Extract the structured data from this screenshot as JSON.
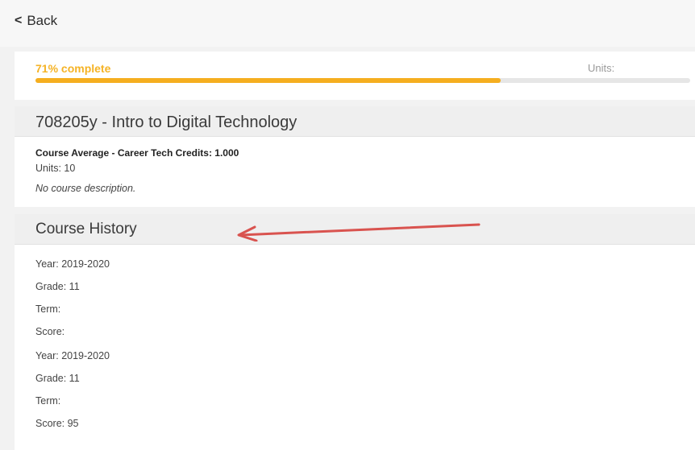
{
  "nav": {
    "back_label": "Back"
  },
  "progress": {
    "label": "71% complete",
    "percent": 71,
    "units_label": "Units:",
    "color": "#f5ae1f"
  },
  "course": {
    "title": "708205y - Intro to Digital Technology",
    "average_line": "Course Average - Career Tech Credits: 1.000",
    "units_line": "Units: 10",
    "description": "No course description."
  },
  "history": {
    "title": "Course History",
    "annotation_color": "#d9534f",
    "entries": [
      {
        "year": "Year: 2019-2020",
        "grade": "Grade: 11",
        "term": "Term:",
        "score": "Score:"
      },
      {
        "year": "Year: 2019-2020",
        "grade": "Grade: 11",
        "term": "Term:",
        "score": "Score: 95"
      }
    ]
  }
}
